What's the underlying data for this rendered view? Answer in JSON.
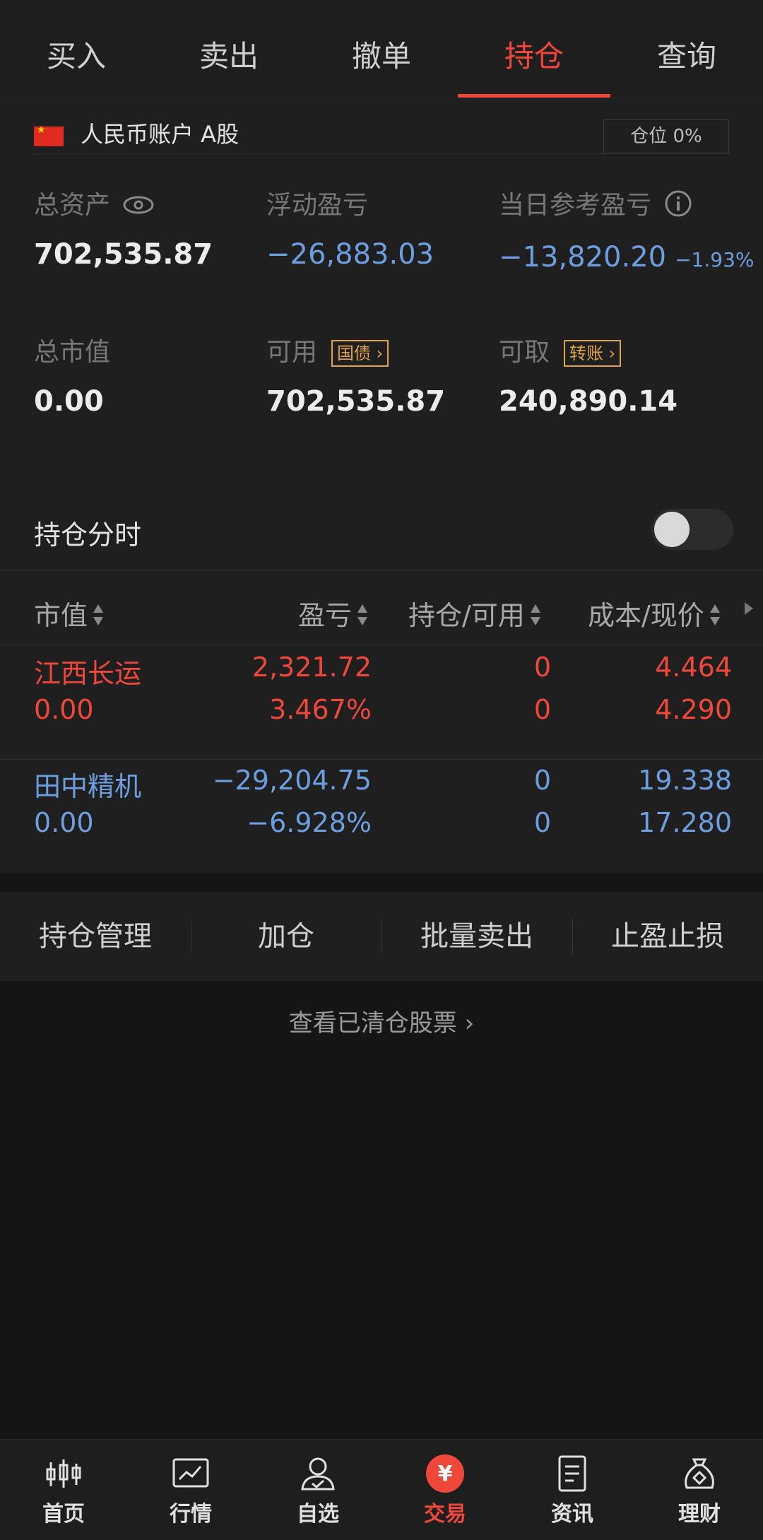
{
  "tabs": [
    "买入",
    "卖出",
    "撤单",
    "持仓",
    "查询"
  ],
  "account": {
    "name": "人民币账户 A股",
    "position_ratio": "仓位 0%",
    "total_assets_label": "总资产",
    "total_assets": "702,535.87",
    "floating_pl_label": "浮动盈亏",
    "floating_pl": "−26,883.03",
    "daily_pl_label": "当日参考盈亏",
    "daily_pl": "−13,820.20",
    "daily_pl_pct": "−1.93%",
    "market_value_label": "总市值",
    "market_value": "0.00",
    "available_label": "可用",
    "available": "702,535.87",
    "bond_badge": "国债",
    "withdrawable_label": "可取",
    "withdrawable": "240,890.14",
    "transfer_badge": "转账"
  },
  "holdings": {
    "title": "持仓分时",
    "toggle_on": false,
    "columns": [
      "市值",
      "盈亏",
      "持仓/可用",
      "成本/现价"
    ],
    "rows": [
      {
        "name": "江西长运",
        "market_value": "0.00",
        "pl": "2,321.72",
        "pl_pct": "3.467%",
        "hold": "0",
        "available": "0",
        "cost": "4.464",
        "price": "4.290",
        "color": "#f0473b"
      },
      {
        "name": "田中精机",
        "market_value": "0.00",
        "pl": "−29,204.75",
        "pl_pct": "−6.928%",
        "hold": "0",
        "available": "0",
        "cost": "19.338",
        "price": "17.280",
        "color": "#6c9ee0"
      }
    ]
  },
  "actions": [
    "持仓管理",
    "加仓",
    "批量卖出",
    "止盈止损"
  ],
  "cleared_link": "查看已清仓股票",
  "bottom_nav": [
    {
      "label": "首页",
      "icon": "candlestick-icon"
    },
    {
      "label": "行情",
      "icon": "chart-icon"
    },
    {
      "label": "自选",
      "icon": "user-check-icon"
    },
    {
      "label": "交易",
      "icon": "yuan-icon"
    },
    {
      "label": "资讯",
      "icon": "document-icon"
    },
    {
      "label": "理财",
      "icon": "money-bag-icon"
    }
  ]
}
